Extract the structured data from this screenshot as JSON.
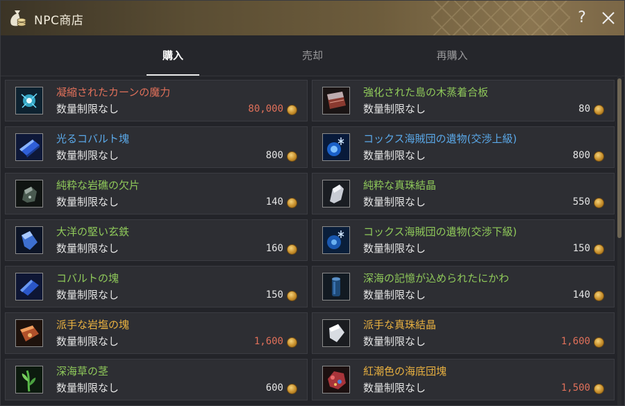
{
  "window": {
    "title": "NPC商店",
    "help": "?"
  },
  "tabs": [
    {
      "label": "購入",
      "active": true
    },
    {
      "label": "売却",
      "active": false
    },
    {
      "label": "再購入",
      "active": false
    }
  ],
  "colors": {
    "green": "#8fc95a",
    "red": "#e0705a",
    "blue": "#5aa8e8",
    "orange": "#e8b040"
  },
  "items": [
    {
      "name": "凝縮されたカーンの魔力",
      "limit": "数量制限なし",
      "price": "80,000",
      "name_color": "red",
      "price_color": "red",
      "icon": "kharn-energy-icon"
    },
    {
      "name": "強化された島の木蒸着合板",
      "limit": "数量制限なし",
      "price": "80",
      "name_color": "green",
      "price_color": "normal",
      "icon": "plywood-icon"
    },
    {
      "name": "光るコバルト塊",
      "limit": "数量制限なし",
      "price": "800",
      "name_color": "blue",
      "price_color": "normal",
      "icon": "shining-cobalt-icon"
    },
    {
      "name": "コックス海賊団の遺物(交渉上級)",
      "limit": "数量制限なし",
      "price": "800",
      "name_color": "blue",
      "price_color": "normal",
      "icon": "pirate-relic-icon"
    },
    {
      "name": "純粋な岩礁の欠片",
      "limit": "数量制限なし",
      "price": "140",
      "name_color": "green",
      "price_color": "normal",
      "icon": "reef-fragment-icon"
    },
    {
      "name": "純粋な真珠結晶",
      "limit": "数量制限なし",
      "price": "550",
      "name_color": "green",
      "price_color": "normal",
      "icon": "pearl-crystal-icon"
    },
    {
      "name": "大洋の堅い玄鉄",
      "limit": "数量制限なし",
      "price": "160",
      "name_color": "green",
      "price_color": "normal",
      "icon": "ocean-iron-icon"
    },
    {
      "name": "コックス海賊団の遺物(交渉下級)",
      "limit": "数量制限なし",
      "price": "150",
      "name_color": "green",
      "price_color": "normal",
      "icon": "pirate-relic-icon"
    },
    {
      "name": "コバルトの塊",
      "limit": "数量制限なし",
      "price": "150",
      "name_color": "green",
      "price_color": "normal",
      "icon": "cobalt-lump-icon"
    },
    {
      "name": "深海の記憶が込められたにかわ",
      "limit": "数量制限なし",
      "price": "140",
      "name_color": "green",
      "price_color": "normal",
      "icon": "glue-icon"
    },
    {
      "name": "派手な岩塩の塊",
      "limit": "数量制限なし",
      "price": "1,600",
      "name_color": "orange",
      "price_color": "red",
      "icon": "rock-salt-icon"
    },
    {
      "name": "派手な真珠結晶",
      "limit": "数量制限なし",
      "price": "1,600",
      "name_color": "orange",
      "price_color": "red",
      "icon": "flashy-pearl-icon"
    },
    {
      "name": "深海草の茎",
      "limit": "数量制限なし",
      "price": "600",
      "name_color": "green",
      "price_color": "normal",
      "icon": "seaweed-stem-icon"
    },
    {
      "name": "紅潮色の海底団塊",
      "limit": "数量制限なし",
      "price": "1,500",
      "name_color": "orange",
      "price_color": "red",
      "icon": "red-nodule-icon"
    }
  ]
}
